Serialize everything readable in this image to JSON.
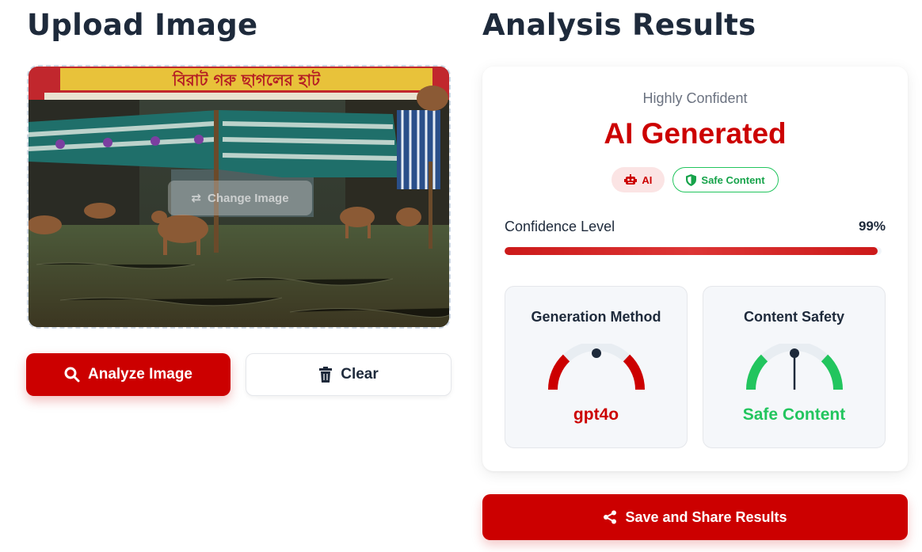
{
  "upload": {
    "title": "Upload Image",
    "change_image_label": "Change Image",
    "analyze_label": "Analyze Image",
    "clear_label": "Clear",
    "image_sign_text": "বিরাট গরু ছাগলের হাট"
  },
  "results": {
    "title": "Analysis Results",
    "confidence_text": "Highly Confident",
    "verdict": "AI Generated",
    "badges": {
      "ai": "AI",
      "safe": "Safe Content"
    },
    "confidence_label": "Confidence Level",
    "confidence_value": "99%",
    "confidence_fraction": 0.99,
    "generation": {
      "title": "Generation Method",
      "value": "gpt4o"
    },
    "safety": {
      "title": "Content Safety",
      "value": "Safe Content"
    },
    "share_label": "Save and Share Results"
  },
  "colors": {
    "accent": "#cc0000",
    "safe": "#22c55e",
    "heading": "#1e2a3b"
  },
  "icons": [
    "swap-icon",
    "search-icon",
    "trash-icon",
    "robot-icon",
    "shield-icon",
    "share-icon"
  ]
}
